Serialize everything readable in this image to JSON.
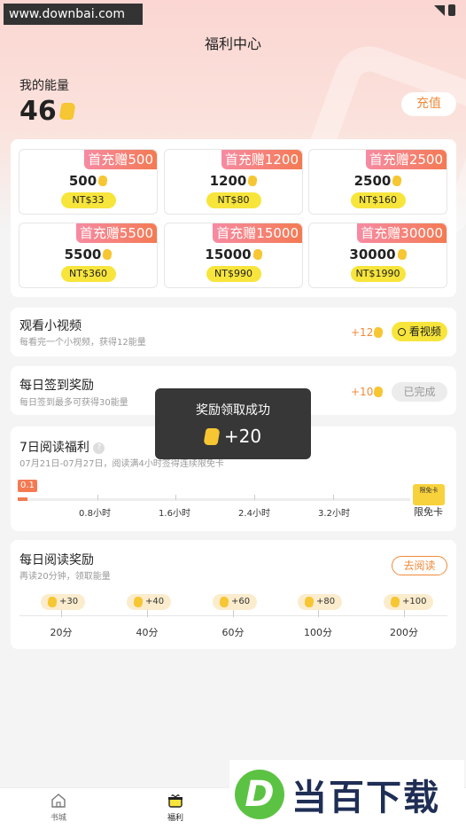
{
  "watermark_site": "www.downbai.com",
  "header": {
    "title": "福利中心"
  },
  "energy": {
    "label": "我的能量",
    "value": "46",
    "recharge_label": "充值"
  },
  "packs": [
    {
      "promo": "首充赠500",
      "amount": "500",
      "price": "NT$33"
    },
    {
      "promo": "首充赠1200",
      "amount": "1200",
      "price": "NT$80"
    },
    {
      "promo": "首充赠2500",
      "amount": "2500",
      "price": "NT$160"
    },
    {
      "promo": "首充赠5500",
      "amount": "5500",
      "price": "NT$360"
    },
    {
      "promo": "首充赠15000",
      "amount": "15000",
      "price": "NT$990"
    },
    {
      "promo": "首充赠30000",
      "amount": "30000",
      "price": "NT$1990"
    }
  ],
  "video_task": {
    "title": "观看小视频",
    "subtitle": "每看完一个小视频，获得12能量",
    "reward": "+12",
    "button": "看视频"
  },
  "checkin_task": {
    "title": "每日签到奖励",
    "subtitle": "每日签到最多可获得30能量",
    "reward": "+10",
    "button": "已完成"
  },
  "toast": {
    "message": "奖励领取成功",
    "amount": "+20"
  },
  "seven_day": {
    "title": "7日阅读福利",
    "subtitle": "07月21日-07月27日，阅读满4小时签得连续限免卡",
    "current": "0.1",
    "progress": 0.025,
    "ticks": [
      "0.8小时",
      "1.6小时",
      "2.4小时",
      "3.2小时"
    ],
    "free_card_text": "限免卡",
    "free_card_badge": "限免卡"
  },
  "daily_read": {
    "title": "每日阅读奖励",
    "subtitle": "再读20分钟，领取能量",
    "button": "去阅读",
    "milestones": [
      {
        "reward": "+30",
        "time": "20分"
      },
      {
        "reward": "+40",
        "time": "40分"
      },
      {
        "reward": "+60",
        "time": "60分"
      },
      {
        "reward": "+80",
        "time": "100分"
      },
      {
        "reward": "+100",
        "time": "200分"
      }
    ]
  },
  "tabbar": [
    {
      "label": "书城",
      "icon": "home-icon"
    },
    {
      "label": "福利",
      "icon": "gift-icon",
      "active": true
    }
  ],
  "logo_watermark": {
    "letter": "D",
    "text": "当百下载"
  },
  "colors": {
    "accent": "#f08a3a",
    "promo": "#f47a52",
    "price_pill": "#f7e53c",
    "coin": "#f6c633"
  }
}
